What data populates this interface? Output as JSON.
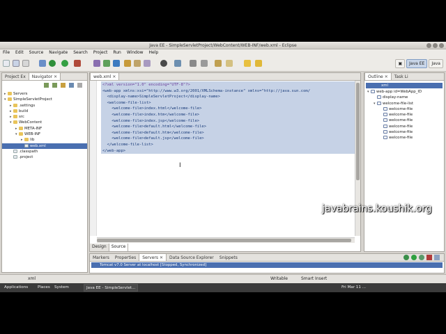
{
  "window": {
    "title": "Java EE - SimpleServletProject/WebContent/WEB-INF/web.xml - Eclipse"
  },
  "menu": [
    "File",
    "Edit",
    "Source",
    "Navigate",
    "Search",
    "Project",
    "Run",
    "Window",
    "Help"
  ],
  "perspectives": {
    "java_ee": "Java EE",
    "java": "Java"
  },
  "left_panel": {
    "tabs": [
      "Project Ex",
      "Navigator"
    ],
    "tree": [
      {
        "label": "Servers",
        "depth": 0,
        "expanded": false
      },
      {
        "label": "SimpleServletProject",
        "depth": 0,
        "expanded": true
      },
      {
        "label": ".settings",
        "depth": 1,
        "expanded": false
      },
      {
        "label": "build",
        "depth": 1,
        "expanded": false
      },
      {
        "label": "src",
        "depth": 1,
        "expanded": false
      },
      {
        "label": "WebContent",
        "depth": 1,
        "expanded": true
      },
      {
        "label": "META-INF",
        "depth": 2,
        "expanded": false
      },
      {
        "label": "WEB-INF",
        "depth": 2,
        "expanded": true
      },
      {
        "label": "lib",
        "depth": 3,
        "expanded": false
      },
      {
        "label": "web.xml",
        "depth": 3,
        "selected": true
      },
      {
        "label": ".classpath",
        "depth": 1
      },
      {
        "label": ".project",
        "depth": 1
      }
    ]
  },
  "editor": {
    "tab_label": "web.xml",
    "lines": [
      "<?xml version=\"1.0\" encoding=\"UTF-8\"?>",
      "<web-app xmlns:xsi=\"http://www.w3.org/2001/XMLSchema-instance\" xmlns=\"http://java.sun.com/",
      "  <display-name>SimpleServletProject</display-name>",
      "  <welcome-file-list>",
      "    <welcome-file>index.html</welcome-file>",
      "    <welcome-file>index.htm</welcome-file>",
      "    <welcome-file>index.jsp</welcome-file>",
      "    <welcome-file>default.html</welcome-file>",
      "    <welcome-file>default.htm</welcome-file>",
      "    <welcome-file>default.jsp</welcome-file>",
      "  </welcome-file-list>",
      "</web-app>"
    ],
    "bottom_tabs": [
      "Design",
      "Source"
    ]
  },
  "outline": {
    "tabs": [
      "Outline",
      "Task Li"
    ],
    "root": "xml",
    "items": [
      {
        "label": "web-app id=WebApp_ID",
        "depth": 0
      },
      {
        "label": "display-name",
        "depth": 1
      },
      {
        "label": "welcome-file-list",
        "depth": 1
      },
      {
        "label": "welcome-file",
        "depth": 2
      },
      {
        "label": "welcome-file",
        "depth": 2
      },
      {
        "label": "welcome-file",
        "depth": 2
      },
      {
        "label": "welcome-file",
        "depth": 2
      },
      {
        "label": "welcome-file",
        "depth": 2
      },
      {
        "label": "welcome-file",
        "depth": 2
      }
    ]
  },
  "bottom_panel": {
    "tabs": [
      "Markers",
      "Properties",
      "Servers",
      "Data Source Explorer",
      "Snippets"
    ],
    "server_row": "Tomcat v7.0 Server at localhost  [Stopped, Synchronized]"
  },
  "status_bar": {
    "left": "xml",
    "writable": "Writable",
    "insert_mode": "Smart Insert"
  },
  "taskbar": {
    "applications": "Applications",
    "places": "Places",
    "system": "System",
    "window_item": "Java EE - SimpleServlet...",
    "clock": "Fri Mar 11 ..."
  },
  "watermark": "javabrains.koushik.org"
}
